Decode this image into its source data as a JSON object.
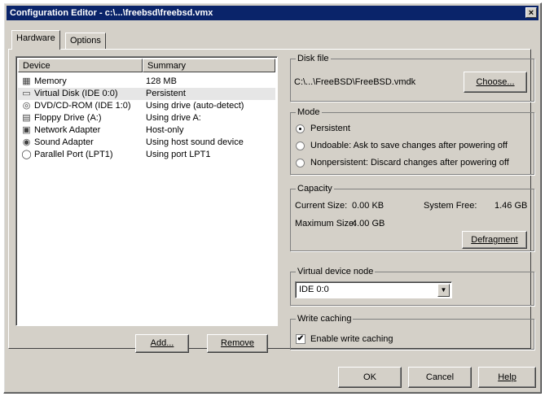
{
  "window": {
    "title": "Configuration Editor - c:\\...\\freebsd\\freebsd.vmx",
    "close_glyph": "×"
  },
  "tabs": [
    {
      "label": "Hardware"
    },
    {
      "label": "Options"
    }
  ],
  "device_list": {
    "columns": [
      "Device",
      "Summary"
    ],
    "rows": [
      {
        "device": "Memory",
        "summary": "128 MB",
        "icon": "memory-icon",
        "glyph": "▦"
      },
      {
        "device": "Virtual Disk (IDE 0:0)",
        "summary": "Persistent",
        "icon": "disk-icon",
        "glyph": "▭"
      },
      {
        "device": "DVD/CD-ROM (IDE 1:0)",
        "summary": "Using drive (auto-detect)",
        "icon": "cdrom-icon",
        "glyph": "◎"
      },
      {
        "device": "Floppy Drive (A:)",
        "summary": "Using drive A:",
        "icon": "floppy-icon",
        "glyph": "▤"
      },
      {
        "device": "Network Adapter",
        "summary": "Host-only",
        "icon": "network-icon",
        "glyph": "▣"
      },
      {
        "device": "Sound Adapter",
        "summary": "Using host sound device",
        "icon": "sound-icon",
        "glyph": "◉"
      },
      {
        "device": "Parallel Port (LPT1)",
        "summary": "Using port LPT1",
        "icon": "parallel-port-icon",
        "glyph": "◯"
      }
    ]
  },
  "list_buttons": {
    "add": "Add...",
    "remove": "Remove"
  },
  "disk_file": {
    "group_label": "Disk file",
    "path": "C:\\...\\FreeBSD\\FreeBSD.vmdk",
    "choose": "Choose..."
  },
  "mode": {
    "group_label": "Mode",
    "options": [
      {
        "label": "Persistent",
        "selected": true
      },
      {
        "label": "Undoable: Ask to save changes after powering off",
        "selected": false
      },
      {
        "label": "Nonpersistent: Discard changes after powering off",
        "selected": false
      }
    ]
  },
  "capacity": {
    "group_label": "Capacity",
    "current_size_label": "Current Size:",
    "current_size": "0.00 KB",
    "system_free_label": "System Free:",
    "system_free": "1.46 GB",
    "maximum_size_label": "Maximum Size:",
    "maximum_size": "4.00 GB",
    "defragment": "Defragment"
  },
  "virtual_device_node": {
    "group_label": "Virtual device node",
    "value": "IDE 0:0"
  },
  "write_caching": {
    "group_label": "Write caching",
    "checkbox_label": "Enable write caching",
    "checked": true,
    "check_glyph": "✔"
  },
  "footer_buttons": {
    "ok": "OK",
    "cancel": "Cancel",
    "help": "Help"
  }
}
